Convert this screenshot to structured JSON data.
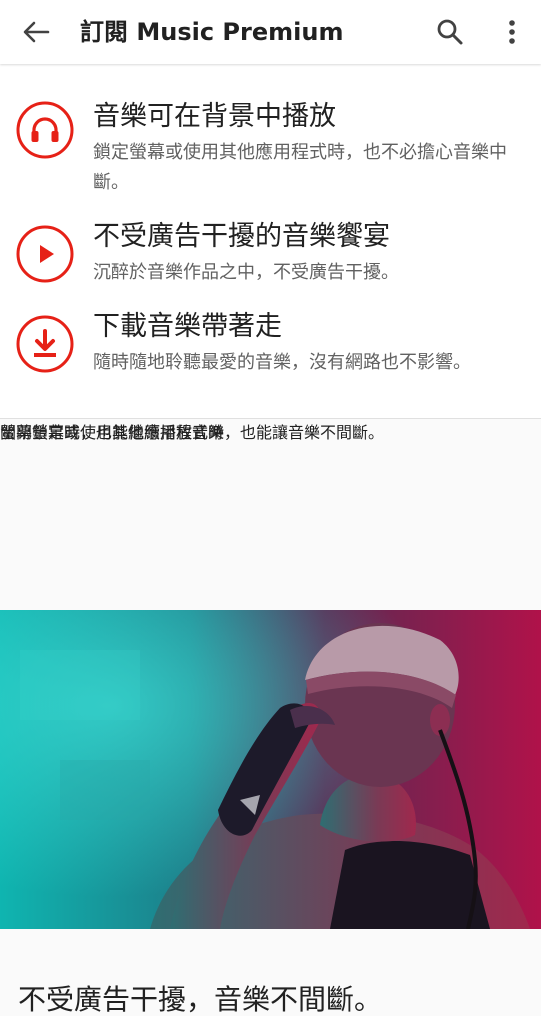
{
  "appbar": {
    "title": "訂閱 Music Premium",
    "icons": [
      "arrow-back-icon",
      "search-icon",
      "more-vert-icon"
    ]
  },
  "colors": {
    "accent": "#e62117",
    "text_primary": "#212121",
    "text_secondary": "#616161"
  },
  "benefits": [
    {
      "icon": "headphones-icon",
      "title": "音樂可在背景中播放",
      "description": "鎖定螢幕或使用其他應用程式時，也不必擔心音樂中斷。"
    },
    {
      "icon": "play-icon",
      "title": "不受廣告干擾的音樂饗宴",
      "description": "沉醉於音樂作品之中，不受廣告干擾。"
    },
    {
      "icon": "download-icon",
      "title": "下載音樂帶著走",
      "description": "隨時隨地聆聽最愛的音樂，沒有網路也不影響。"
    }
  ],
  "features": [
    {
      "title": "螢幕鎖定時，也能繼續播放音樂",
      "description": "關閉螢幕或使用其他應用程式時，也能讓音樂不間斷。"
    },
    {
      "title": "不受廣告干擾，音樂不間斷。"
    }
  ]
}
